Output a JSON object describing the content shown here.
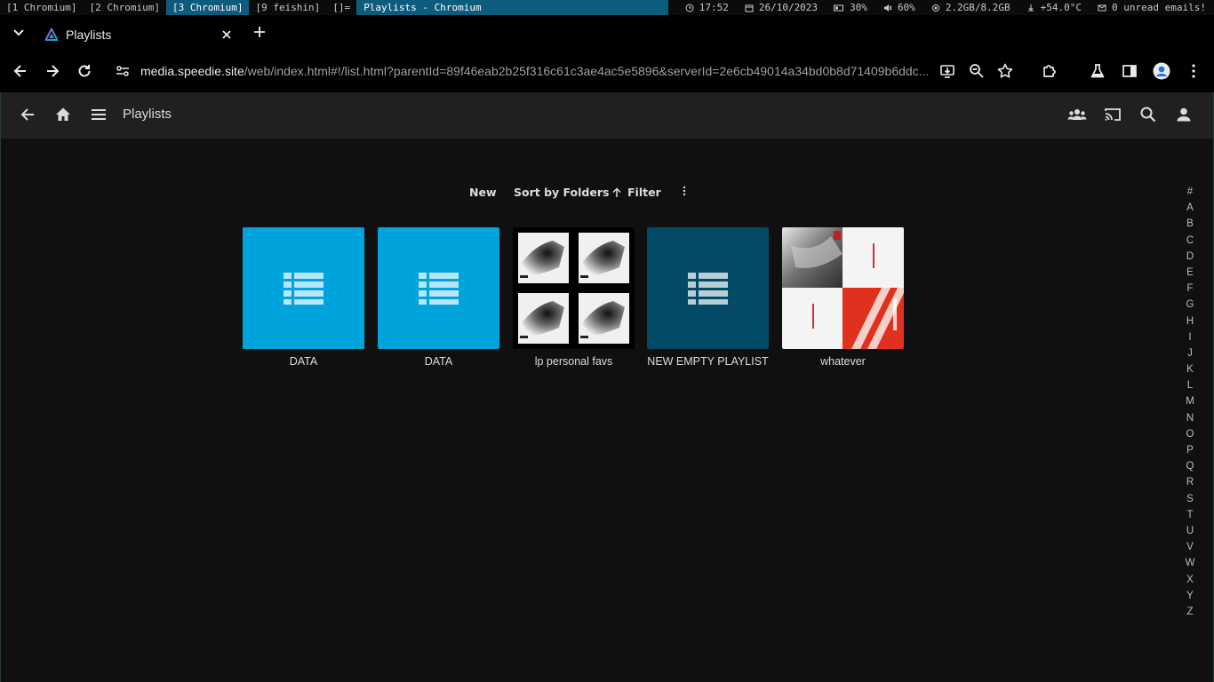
{
  "wm": {
    "workspaces": [
      "[1 Chromium]",
      "[2 Chromium]",
      "[3 Chromium]",
      "[9 feishin]",
      "[]="
    ],
    "active_index": 2,
    "window_title": "Playlists - Chromium",
    "status": {
      "time": "17:52",
      "date": "26/10/2023",
      "battery": "30%",
      "volume": "60%",
      "memory": "2.2GB/8.2GB",
      "temp": "+54.0°C",
      "mail": "0 unread emails!"
    }
  },
  "browser": {
    "tab_title": "Playlists",
    "url_host": "media.speedie.site",
    "url_path": "/web/index.html#!/list.html?parentId=89f46eab2b25f316c61c3ae4ac5e5896&serverId=2e6cb49014a34bd0b8d71409b6ddc..."
  },
  "app": {
    "page_title": "Playlists",
    "controls": {
      "new_label": "New",
      "sort_label": "Sort by Folders",
      "filter_label": "Filter"
    },
    "playlists": [
      {
        "label": "DATA",
        "kind": "placeholder",
        "color": "#00a4dc"
      },
      {
        "label": "DATA",
        "kind": "placeholder",
        "color": "#00a4dc"
      },
      {
        "label": "lp personal favs",
        "kind": "collage-bw"
      },
      {
        "label": "NEW EMPTY PLAYLIST",
        "kind": "placeholder",
        "color": "#024a66"
      },
      {
        "label": "whatever",
        "kind": "collage-red"
      }
    ],
    "alphabet": [
      "#",
      "A",
      "B",
      "C",
      "D",
      "E",
      "F",
      "G",
      "H",
      "I",
      "J",
      "K",
      "L",
      "M",
      "N",
      "O",
      "P",
      "Q",
      "R",
      "S",
      "T",
      "U",
      "V",
      "W",
      "X",
      "Y",
      "Z"
    ]
  },
  "colors": {
    "accent": "#00a4dc",
    "header_bg": "#202020",
    "page_bg": "#101010",
    "wm_active": "#0d5c7d"
  }
}
